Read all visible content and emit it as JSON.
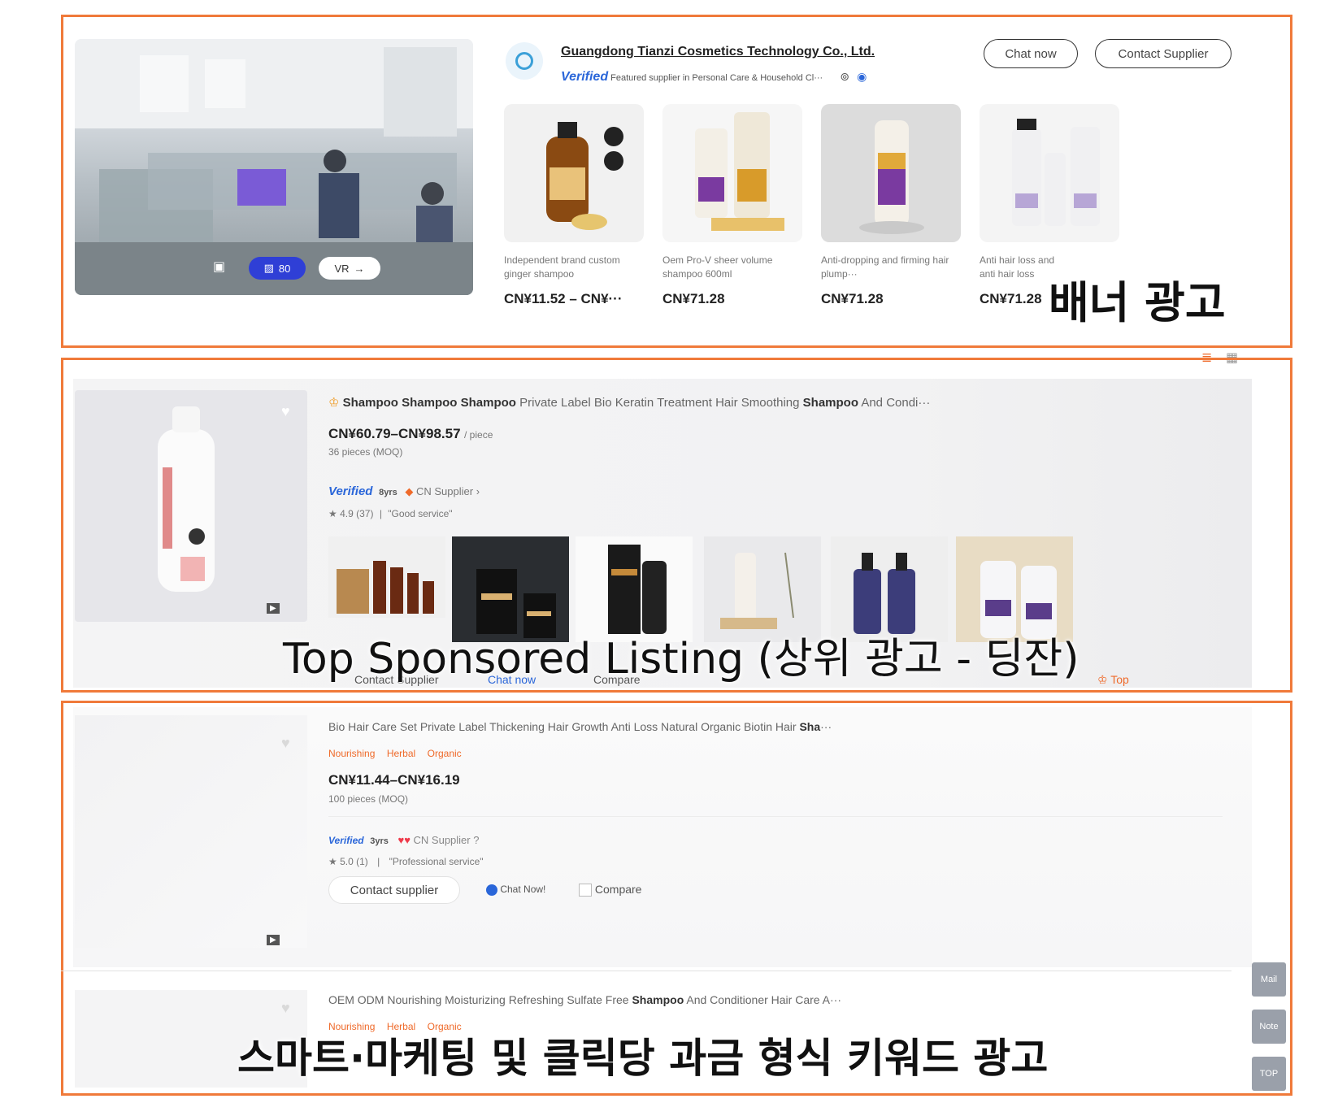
{
  "banner": {
    "company": "Guangdong Tianzi Cosmetics Technology Co., Ltd.",
    "verified": "Verified",
    "verified_desc": "Featured supplier in Personal Care & Household Cl···",
    "chat_label": "Chat now",
    "contact_label": "Contact Supplier",
    "vr_label": "VR",
    "photo_count": "80",
    "products": [
      {
        "title": "Independent brand custom ginger shampoo",
        "price": "CN¥11.52 – CN¥···"
      },
      {
        "title": "Oem Pro-V sheer volume shampoo 600ml",
        "price": "CN¥71.28"
      },
      {
        "title": "Anti-dropping and firming hair plump···",
        "price": "CN¥71.28"
      },
      {
        "title": "Anti hair loss and anti hair loss thin···",
        "price": "CN¥71.28"
      }
    ],
    "overlay": "배너 광고"
  },
  "sponsored": {
    "title_prefix": "Shampoo Shampoo Shampoo",
    "title_rest": " Private Label Bio Keratin Treatment Hair Smoothing ",
    "title_bold2": "Shampoo",
    "title_end": " And Condi···",
    "price": "CN¥60.79–CN¥98.57",
    "unit": "/ piece",
    "moq": "36 pieces",
    "moq_suffix": "(MOQ)",
    "verified": "Verified",
    "supplier_years": "8yrs",
    "supplier_type": "CN Supplier",
    "rating": "4.9 (37)",
    "review": "\"Good service\"",
    "contact_label": "Contact Supplier",
    "chat_label": "Chat now",
    "compare_label": "Compare",
    "top_label": "Top",
    "overlay": "Top Sponsored Listing (상위 광고 - 딩잔)"
  },
  "keyword": {
    "item1": {
      "title": "Bio Hair Care Set Private Label Thickening Hair Growth Anti Loss Natural Organic Biotin Hair ",
      "title_bold": "Sha",
      "title_end": "···",
      "tags": [
        "Nourishing",
        "Herbal",
        "Organic"
      ],
      "price": "CN¥11.44–CN¥16.19",
      "moq": "100 pieces",
      "moq_suffix": "(MOQ)",
      "verified": "Verified",
      "supplier_years": "3yrs",
      "supplier_type": "CN Supplier",
      "rating": "5.0 (1)",
      "review": "\"Professional service\"",
      "contact_label": "Contact supplier",
      "chat_label": "Chat Now!",
      "compare_label": "Compare"
    },
    "item2": {
      "title": "OEM ODM Nourishing Moisturizing Refreshing Sulfate Free ",
      "title_bold": "Shampoo",
      "title_end": " And Conditioner Hair Care A···",
      "tags": [
        "Nourishing",
        "Herbal",
        "Organic"
      ]
    },
    "overlay": "스마트·마케팅 및 클릭당 과금 형식 키워드 광고"
  },
  "side_buttons": [
    "Mail",
    "Note",
    "TOP"
  ],
  "colors": {
    "frame": "#f07a3a",
    "accent": "#ef6a2a",
    "verified": "#2a66d9"
  }
}
